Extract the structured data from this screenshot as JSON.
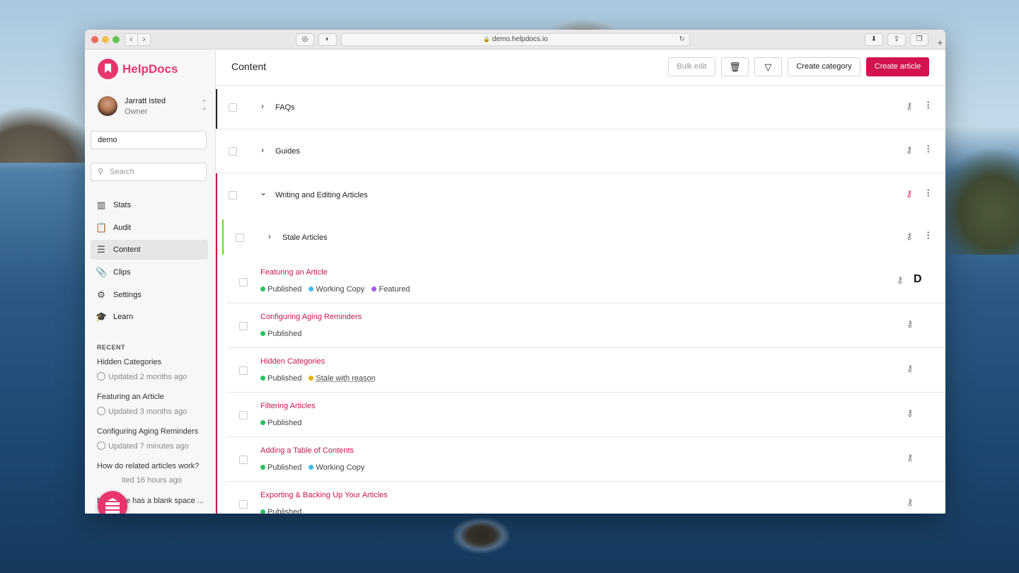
{
  "browser": {
    "url": "demo.helpdocs.io",
    "lock_icon": "lock-icon",
    "back_label": "‹",
    "forward_label": "›"
  },
  "sidebar": {
    "brand": "HelpDocs",
    "user": {
      "name": "Jarratt Isted",
      "role": "Owner"
    },
    "site_value": "demo",
    "search_placeholder": "Search",
    "menu": [
      {
        "label": "Stats",
        "icon": "stats-icon"
      },
      {
        "label": "Audit",
        "icon": "audit-icon"
      },
      {
        "label": "Content",
        "icon": "content-icon",
        "active": true
      },
      {
        "label": "Clips",
        "icon": "clips-icon"
      },
      {
        "label": "Settings",
        "icon": "settings-icon"
      },
      {
        "label": "Learn",
        "icon": "learn-icon"
      }
    ],
    "recent_heading": "RECENT",
    "recent": [
      {
        "title": "Hidden Categories",
        "updated": "Updated 2 months ago"
      },
      {
        "title": "Featuring an Article",
        "updated": "Updated 3 months ago"
      },
      {
        "title": "Configuring Aging Reminders",
        "updated": "Updated 7 minutes ago"
      },
      {
        "title": "How do related articles work?",
        "updated": "ited 16 hours ago"
      },
      {
        "title": "My article has a blank space ..."
      }
    ]
  },
  "main": {
    "title": "Content",
    "toolbar": {
      "bulk_edit": "Bulk edit",
      "create_category": "Create category",
      "create_article": "Create article"
    },
    "categories": [
      {
        "title": "FAQs"
      },
      {
        "title": "Guides"
      },
      {
        "title": "Writing and Editing Articles",
        "expanded": true
      },
      {
        "title": "Stale Articles"
      }
    ],
    "articles": [
      {
        "title": "Featuring an Article",
        "badges": [
          {
            "label": "Published",
            "color": "green"
          },
          {
            "label": "Working Copy",
            "color": "blue"
          },
          {
            "label": "Featured",
            "color": "purple"
          }
        ],
        "extra": "D"
      },
      {
        "title": "Configuring Aging Reminders",
        "badges": [
          {
            "label": "Published",
            "color": "green"
          }
        ]
      },
      {
        "title": "Hidden Categories",
        "badges": [
          {
            "label": "Published",
            "color": "green"
          },
          {
            "label": "Stale with reason",
            "color": "yellow"
          }
        ]
      },
      {
        "title": "Filtering Articles",
        "badges": [
          {
            "label": "Published",
            "color": "green"
          }
        ]
      },
      {
        "title": "Adding a Table of Contents",
        "badges": [
          {
            "label": "Published",
            "color": "green"
          },
          {
            "label": "Working Copy",
            "color": "blue"
          }
        ]
      },
      {
        "title": "Exporting & Backing Up Your Articles",
        "badges": [
          {
            "label": "Published",
            "color": "green"
          }
        ]
      }
    ]
  },
  "colors": {
    "brand": "#e8356d",
    "primary_button": "#d3134f",
    "link": "#c8174f"
  }
}
